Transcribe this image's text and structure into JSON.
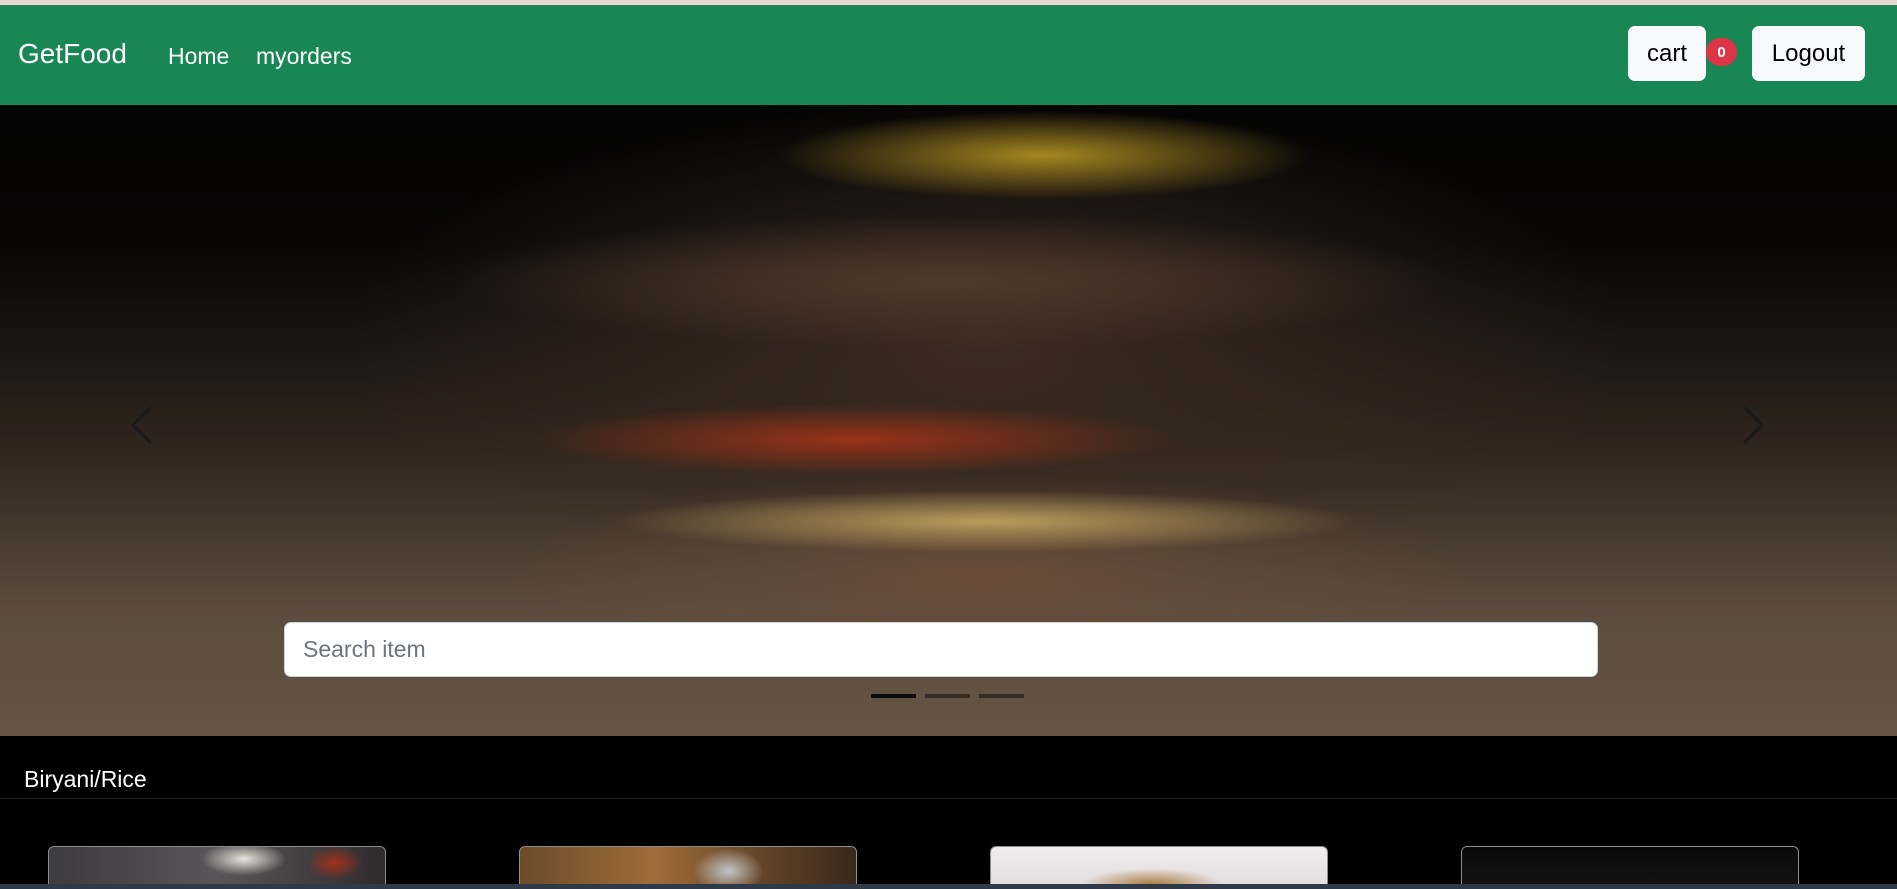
{
  "navbar": {
    "brand": "GetFood",
    "links": {
      "home": "Home",
      "orders": "myorders"
    },
    "cart_label": "cart",
    "cart_count": "0",
    "logout_label": "Logout",
    "bg_color": "#198754"
  },
  "hero": {
    "search_placeholder": "Search item",
    "active_slide": 1,
    "slide_count": 3,
    "prev_icon": "chevron-left-icon",
    "next_icon": "chevron-right-icon"
  },
  "category": {
    "title": "Biryani/Rice",
    "visible_cards": 4
  }
}
